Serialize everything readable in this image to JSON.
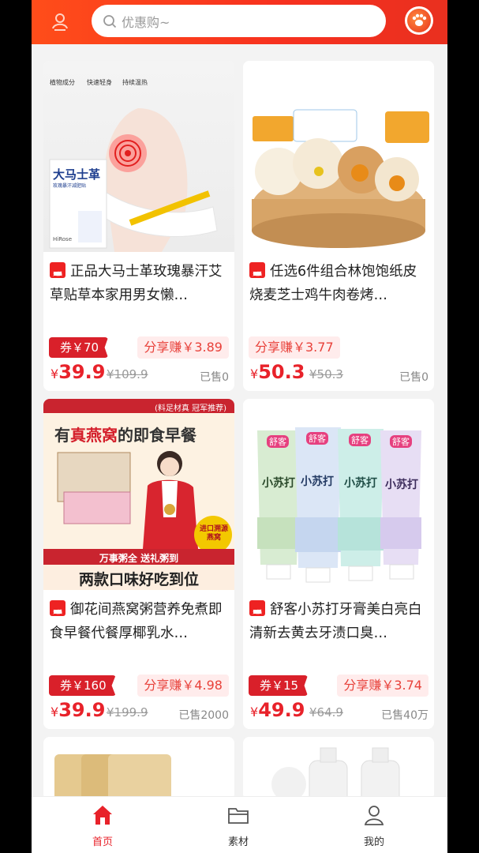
{
  "header": {
    "search_placeholder": "优惠购~"
  },
  "products": [
    {
      "title": "正品大马士革玫瑰暴汗艾草贴草本家用男女懒…",
      "coupon": "券￥70",
      "share": "分享赚￥3.89",
      "price_symbol": "¥",
      "price": "39.9",
      "original": "¥109.9",
      "sold": "已售0",
      "image_text": {
        "features": [
          "植物成分",
          "快速轻身",
          "持续温热"
        ],
        "box_title": "大马士革",
        "box_sub": "玫瑰暴汗减肥贴",
        "brand": "HiRose"
      }
    },
    {
      "title": "任选6件组合林饱饱纸皮烧麦芝士鸡牛肉卷烤…",
      "coupon": "",
      "share": "分享赚￥3.77",
      "price_symbol": "¥",
      "price": "50.3",
      "original": "¥50.3",
      "sold": "已售0"
    },
    {
      "title": "御花间燕窝粥营养免煮即食早餐代餐厚椰乳水…",
      "coupon": "券￥160",
      "share": "分享赚￥4.98",
      "price_symbol": "¥",
      "price": "39.9",
      "original": "¥199.9",
      "sold": "已售2000",
      "image_text": {
        "top_right": "(料足材真 冠军推荐)",
        "headline_a": "有",
        "headline_b": "真燕窝",
        "headline_c": "的即食早餐",
        "badge": "进口溯源 燕窝",
        "ribbon": "万事粥全 送礼粥到",
        "bottom": "两款口味好吃到位"
      }
    },
    {
      "title": "舒客小苏打牙膏美白亮白清新去黄去牙渍口臭…",
      "coupon": "券￥15",
      "share": "分享赚￥3.74",
      "price_symbol": "¥",
      "price": "49.9",
      "original": "¥64.9",
      "sold": "已售40万",
      "image_text": {
        "brand": "舒客",
        "product": "小苏打"
      }
    }
  ],
  "tabbar": {
    "items": [
      {
        "label": "首页",
        "active": true
      },
      {
        "label": "素材",
        "active": false
      },
      {
        "label": "我的",
        "active": false
      }
    ]
  },
  "colors": {
    "header": "#f7311f",
    "price": "#e8222a",
    "coupon_bg": "#d9202a",
    "share_bg": "#ffecec"
  }
}
